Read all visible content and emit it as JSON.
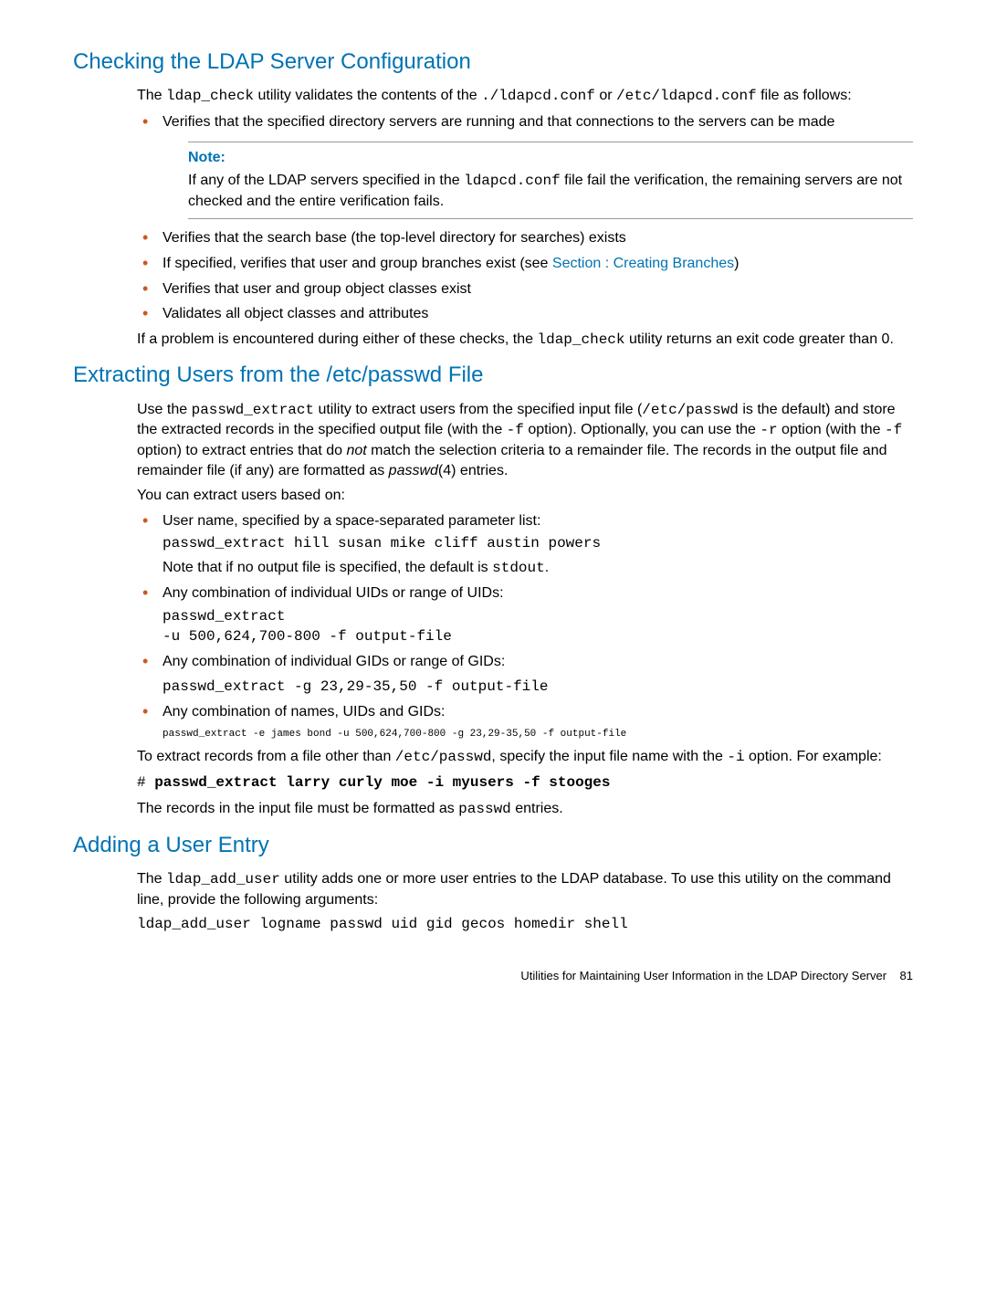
{
  "section1": {
    "heading": "Checking the LDAP Server Configuration",
    "intro_pre": "The ",
    "intro_code1": "ldap_check",
    "intro_mid1": " utility validates the contents of the ",
    "intro_code2": "./ldapcd.conf",
    "intro_mid2": " or ",
    "intro_code3": "/etc/ldapcd.conf",
    "intro_post": " file as follows:",
    "bullet1": "Verifies that the specified directory servers are running and that connections to the servers can be made",
    "note_title": "Note:",
    "note_pre": "If any of the LDAP servers specified in the ",
    "note_code": "ldapcd.conf",
    "note_post": " file fail the verification, the remaining servers are not checked and the entire verification fails.",
    "bullet2": "Verifies that the search base (the top-level directory for searches) exists",
    "bullet3_pre": "If specified, verifies that user and group branches exist (see ",
    "bullet3_link": "Section : Creating Branches",
    "bullet3_post": ")",
    "bullet4": "Verifies that user and group object classes exist",
    "bullet5": "Validates all object classes and attributes",
    "closing_pre": "If a problem is encountered during either of these checks, the ",
    "closing_code": "ldap_check",
    "closing_post": " utility returns an exit code greater than 0."
  },
  "section2": {
    "heading": "Extracting Users from the /etc/passwd File",
    "p1_pre": "Use the ",
    "p1_code1": "passwd_extract",
    "p1_mid1": " utility to extract users from the specified input file (",
    "p1_code2": "/etc/passwd",
    "p1_mid2": " is the default) and store the extracted records in the specified output file (with the ",
    "p1_code3": "-f",
    "p1_mid3": " option). Optionally, you can use the ",
    "p1_code4": "-r",
    "p1_mid4": " option (with the ",
    "p1_code5": "-f",
    "p1_mid5": " option) to extract entries that do ",
    "p1_italic": "not",
    "p1_mid6": " match the selection criteria to a remainder file. The records in the output file and remainder file (if any) are formatted as ",
    "p1_italic2": "passwd",
    "p1_post": "(4) entries.",
    "p2": "You can extract users based on:",
    "b1_text": "User name, specified by a space-separated parameter list:",
    "b1_code": "passwd_extract hill susan mike cliff austin powers",
    "b1_note_pre": "Note that if no output file is specified, the default is ",
    "b1_note_code": "stdout",
    "b1_note_post": ".",
    "b2_text": "Any combination of individual UIDs or range of UIDs:",
    "b2_code": "passwd_extract\n-u 500,624,700-800 -f output-file",
    "b3_text": "Any combination of individual GIDs or range of GIDs:",
    "b3_code": "passwd_extract -g 23,29-35,50 -f output-file",
    "b4_text": "Any combination of names, UIDs and GIDs:",
    "b4_code": "passwd_extract -e james bond -u 500,624,700-800 -g 23,29-35,50 -f output-file",
    "p3_pre": "To extract records from a file other than ",
    "p3_code1": "/etc/passwd",
    "p3_mid": ", specify the input file name with the ",
    "p3_code2": "-i",
    "p3_post": " option. For example:",
    "example_hash": "# ",
    "example_bold": "passwd_extract larry curly moe -i myusers -f stooges",
    "p4_pre": "The records in the input file must be formatted as ",
    "p4_code": "passwd",
    "p4_post": " entries."
  },
  "section3": {
    "heading": "Adding a User Entry",
    "p1_pre": "The ",
    "p1_code": "ldap_add_user",
    "p1_post": " utility adds one or more user entries to the LDAP database. To use this utility on the command line, provide the following arguments:",
    "code": "ldap_add_user logname passwd uid gid gecos homedir shell"
  },
  "footer": {
    "text": "Utilities for Maintaining User Information in the LDAP Directory Server",
    "page": "81"
  }
}
